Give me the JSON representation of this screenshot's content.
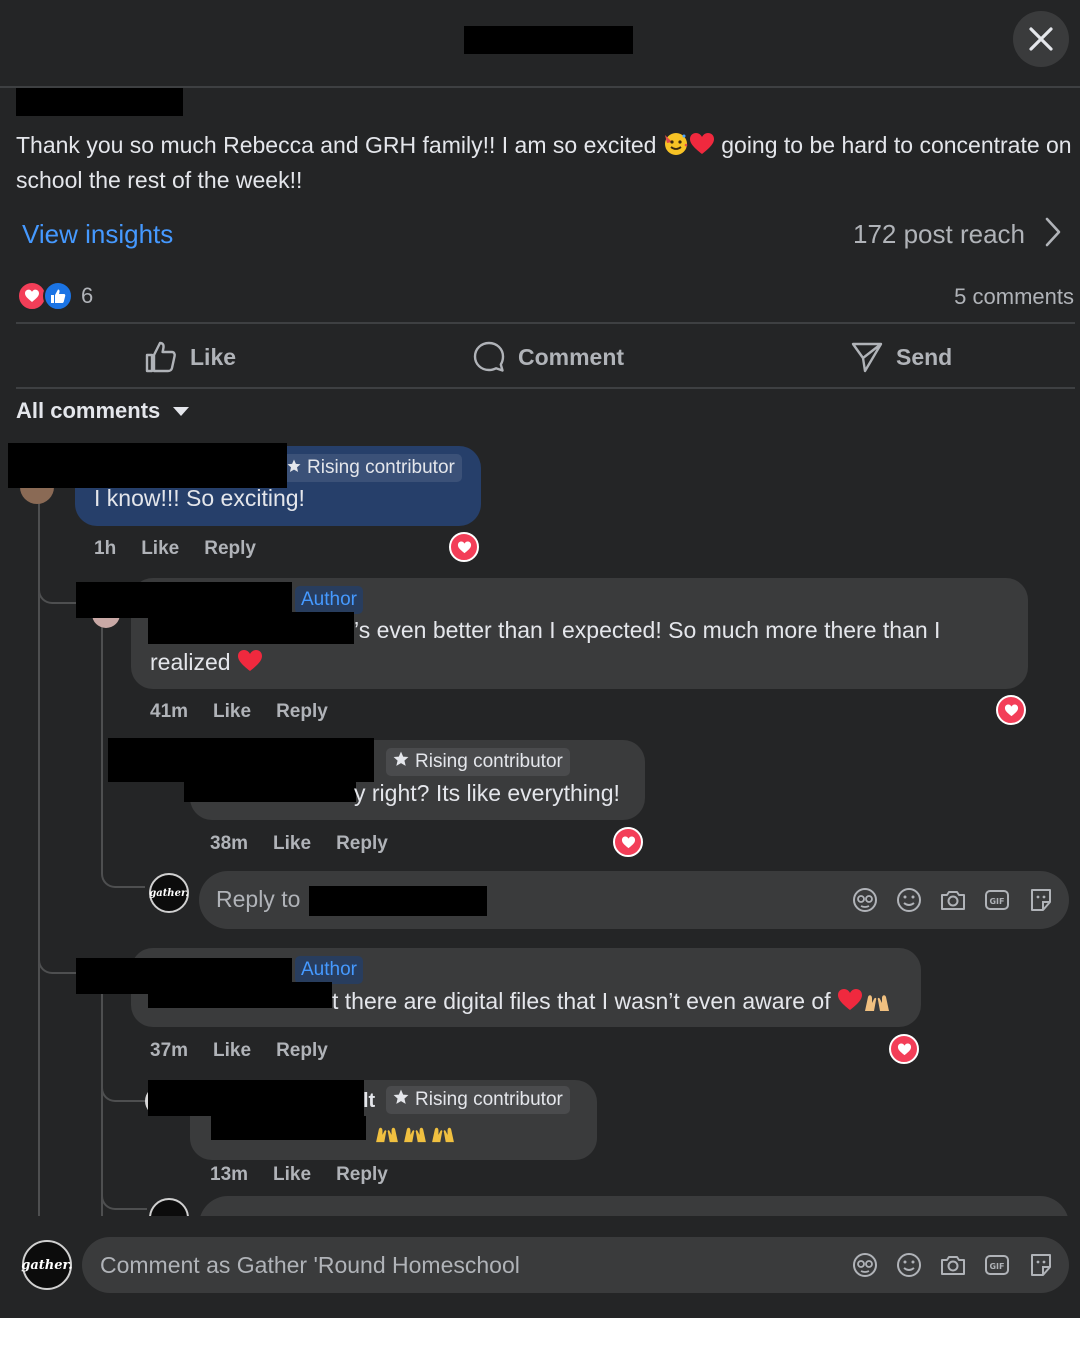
{
  "header": {
    "close_label": "×"
  },
  "post": {
    "text_before_emoji": "Thank you so much Rebecca and GRH family!! I am so excited ",
    "text_after_emoji": " going to be hard to concentrate on school the rest of the week!!",
    "insights_label": "View insights",
    "reach_label": "172 post reach",
    "reaction_count": "6",
    "comment_count_label": "5 comments"
  },
  "actions": {
    "like": "Like",
    "comment": "Comment",
    "send": "Send"
  },
  "filter": {
    "label": "All comments"
  },
  "comments": [
    {
      "badge": "Rising contributor",
      "text": "I know!!! So exciting!",
      "meta": {
        "time": "1h",
        "like": "Like",
        "reply": "Reply"
      }
    },
    {
      "badge": "Author",
      "text_line1": "’s even better than I expected! So much more there than I",
      "text_line2": "realized",
      "meta": {
        "time": "41m",
        "like": "Like",
        "reply": "Reply"
      }
    },
    {
      "badge": "Rising contributor",
      "text": "y right? Its like everything!",
      "meta": {
        "time": "38m",
        "like": "Like",
        "reply": "Reply"
      }
    },
    {
      "badge": "Author",
      "text": "t there are digital files that I wasn’t even aware of",
      "meta": {
        "time": "37m",
        "like": "Like",
        "reply": "Reply"
      }
    },
    {
      "name_fragment": "lt",
      "badge": "Rising contributor",
      "meta": {
        "time": "13m",
        "like": "Like",
        "reply": "Reply"
      }
    }
  ],
  "reply_box": {
    "placeholder": "Reply to"
  },
  "avatar": {
    "label": "gather."
  },
  "composer": {
    "placeholder": "Comment as Gather 'Round Homeschool"
  },
  "colors": {
    "background": "#242526",
    "bubble": "#3a3b3c",
    "link": "#4599ff",
    "heart": "#f33e58",
    "like_blue": "#1b74e4",
    "author_badge": "#283d5e"
  },
  "icons": [
    "close-icon",
    "chevron-right-icon",
    "like-thumb-icon",
    "comment-bubble-icon",
    "send-icon",
    "dropdown-arrow-icon",
    "star-icon",
    "heart-icon",
    "avatar-icon",
    "emoji-icon",
    "camera-icon",
    "gif-icon",
    "sticker-icon"
  ]
}
